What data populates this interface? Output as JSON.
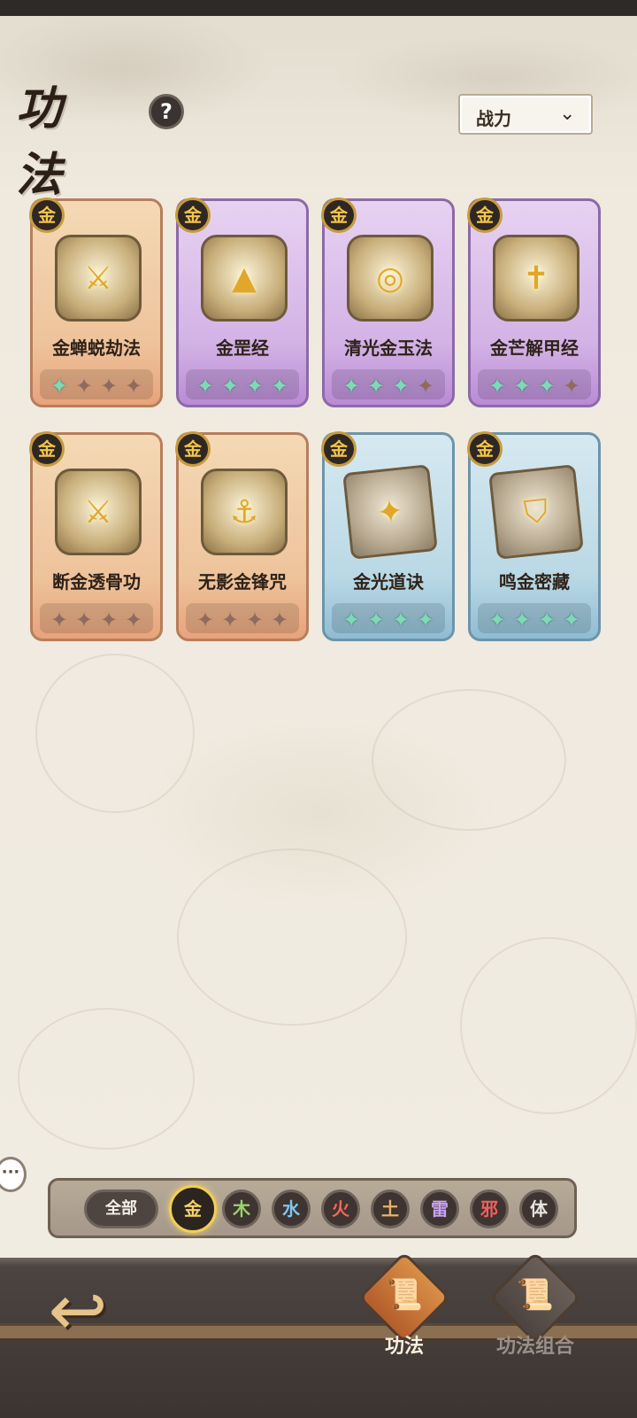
{
  "header": {
    "title": "功法",
    "help_symbol": "?",
    "sort_label": "战力",
    "sort_chevron": "⌄"
  },
  "cards": [
    {
      "badge": "金",
      "name": "金蝉蜕劫法",
      "rarity": "orange",
      "stars_filled": 1,
      "stars_total": 4,
      "icon": "sword-emblem-icon"
    },
    {
      "badge": "金",
      "name": "金罡经",
      "rarity": "purple",
      "stars_filled": 4,
      "stars_total": 4,
      "icon": "stairs-emblem-icon"
    },
    {
      "badge": "金",
      "name": "清光金玉法",
      "rarity": "purple",
      "stars_filled": 3,
      "stars_total": 4,
      "icon": "orb-emblem-icon"
    },
    {
      "badge": "金",
      "name": "金芒解甲经",
      "rarity": "purple",
      "stars_filled": 2.5,
      "stars_total": 4,
      "icon": "sword-down-emblem-icon"
    },
    {
      "badge": "金",
      "name": "断金透骨功",
      "rarity": "orange",
      "stars_filled": 0,
      "stars_total": 4,
      "icon": "sword-emblem-icon"
    },
    {
      "badge": "金",
      "name": "无影金锋咒",
      "rarity": "orange",
      "stars_filled": 0,
      "stars_total": 4,
      "icon": "anchor-emblem-icon"
    },
    {
      "badge": "金",
      "name": "金光道诀",
      "rarity": "blue",
      "stars_filled": 4,
      "stars_total": 4,
      "icon": "starburst-book-icon"
    },
    {
      "badge": "金",
      "name": "鸣金密藏",
      "rarity": "blue",
      "stars_filled": 4,
      "stars_total": 4,
      "icon": "shield-book-icon"
    }
  ],
  "filters": [
    {
      "label": "全部",
      "color": "#f4efe6"
    },
    {
      "label": "金",
      "color": "#f4d36a",
      "active": true
    },
    {
      "label": "木",
      "color": "#9bd36b"
    },
    {
      "label": "水",
      "color": "#7fc6ef"
    },
    {
      "label": "火",
      "color": "#ef6a55"
    },
    {
      "label": "土",
      "color": "#e6b266"
    },
    {
      "label": "雷",
      "color": "#c9a3f0"
    },
    {
      "label": "邪",
      "color": "#f06060"
    },
    {
      "label": "体",
      "color": "#e7e3de"
    }
  ],
  "bottom_nav": {
    "back_icon": "back-arrow-icon",
    "items": [
      {
        "label": "功法",
        "active": true
      },
      {
        "label": "功法组合",
        "active": false
      }
    ]
  },
  "chat_bubble": "···",
  "colors": {
    "accent_gold": "#f0cf54",
    "star_on": "#7fd9b7"
  }
}
